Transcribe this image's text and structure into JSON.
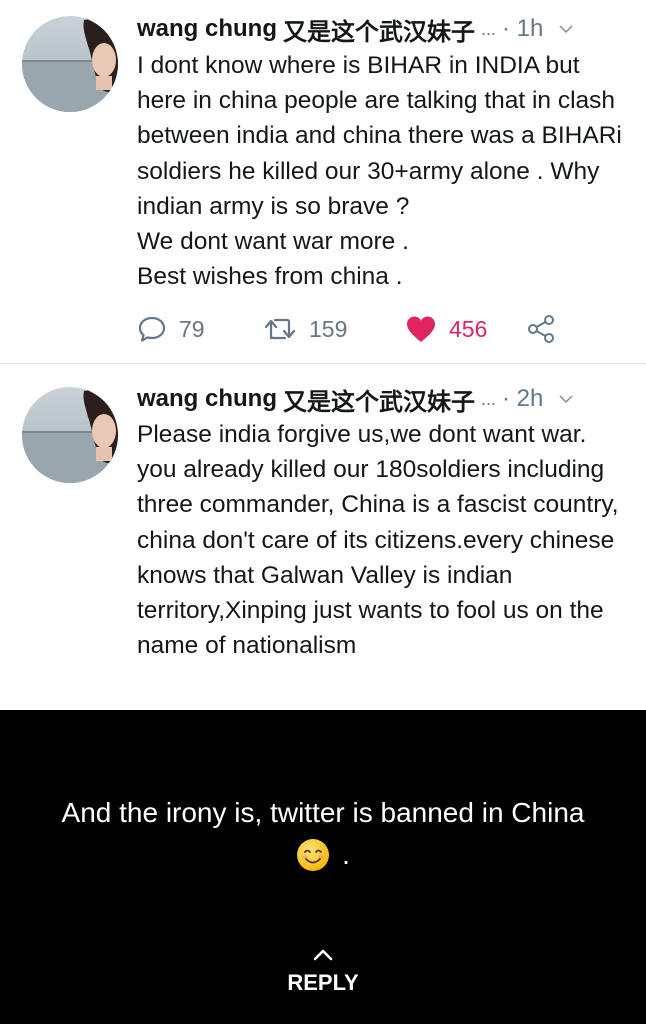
{
  "tweets": [
    {
      "author": "wang chung",
      "author_extra": "又是这个武汉妹子",
      "ellipsis": "...",
      "time": "· 1h",
      "text": "I dont know where is BIHAR in INDIA but here in china people are talking that in clash between india and china there was a BIHARi soldiers he killed our 30+army alone . Why indian army is so brave ?\nWe dont want war more .\nBest wishes from china .",
      "replies": "79",
      "retweets": "159",
      "likes": "456",
      "icons": {
        "reply": "speech-bubble-icon",
        "retweet": "retweet-icon",
        "like": "heart-icon",
        "share": "share-icon"
      }
    },
    {
      "author": "wang chung",
      "author_extra": "又是这个武汉妹子",
      "ellipsis": "...",
      "time": "· 2h",
      "text": "Please india forgive us,we dont want war. you already killed our 180soldiers including three commander, China is a fascist country, china don't care of its citizens.every chinese knows that Galwan Valley is indian territory,Xinping just wants to fool us on the name of nationalism"
    }
  ],
  "caption": {
    "text": "And the irony is, twitter is banned in China",
    "emoji": "smiling-face-emoji",
    "trailing": "."
  },
  "reply_button": {
    "label": "REPLY",
    "icon": "chevron-up-icon"
  },
  "colors": {
    "like": "#e0245e",
    "muted": "#657786",
    "text": "#14171a",
    "caption_bg": "#000000"
  }
}
